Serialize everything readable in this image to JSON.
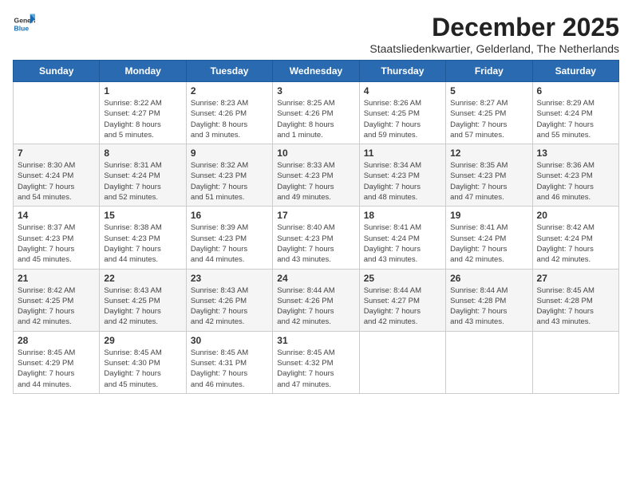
{
  "logo": {
    "line1": "General",
    "line2": "Blue"
  },
  "title": "December 2025",
  "subtitle": "Staatsliedenkwartier, Gelderland, The Netherlands",
  "days_of_week": [
    "Sunday",
    "Monday",
    "Tuesday",
    "Wednesday",
    "Thursday",
    "Friday",
    "Saturday"
  ],
  "weeks": [
    [
      {
        "day": "",
        "text": ""
      },
      {
        "day": "1",
        "text": "Sunrise: 8:22 AM\nSunset: 4:27 PM\nDaylight: 8 hours\nand 5 minutes."
      },
      {
        "day": "2",
        "text": "Sunrise: 8:23 AM\nSunset: 4:26 PM\nDaylight: 8 hours\nand 3 minutes."
      },
      {
        "day": "3",
        "text": "Sunrise: 8:25 AM\nSunset: 4:26 PM\nDaylight: 8 hours\nand 1 minute."
      },
      {
        "day": "4",
        "text": "Sunrise: 8:26 AM\nSunset: 4:25 PM\nDaylight: 7 hours\nand 59 minutes."
      },
      {
        "day": "5",
        "text": "Sunrise: 8:27 AM\nSunset: 4:25 PM\nDaylight: 7 hours\nand 57 minutes."
      },
      {
        "day": "6",
        "text": "Sunrise: 8:29 AM\nSunset: 4:24 PM\nDaylight: 7 hours\nand 55 minutes."
      }
    ],
    [
      {
        "day": "7",
        "text": "Sunrise: 8:30 AM\nSunset: 4:24 PM\nDaylight: 7 hours\nand 54 minutes."
      },
      {
        "day": "8",
        "text": "Sunrise: 8:31 AM\nSunset: 4:24 PM\nDaylight: 7 hours\nand 52 minutes."
      },
      {
        "day": "9",
        "text": "Sunrise: 8:32 AM\nSunset: 4:23 PM\nDaylight: 7 hours\nand 51 minutes."
      },
      {
        "day": "10",
        "text": "Sunrise: 8:33 AM\nSunset: 4:23 PM\nDaylight: 7 hours\nand 49 minutes."
      },
      {
        "day": "11",
        "text": "Sunrise: 8:34 AM\nSunset: 4:23 PM\nDaylight: 7 hours\nand 48 minutes."
      },
      {
        "day": "12",
        "text": "Sunrise: 8:35 AM\nSunset: 4:23 PM\nDaylight: 7 hours\nand 47 minutes."
      },
      {
        "day": "13",
        "text": "Sunrise: 8:36 AM\nSunset: 4:23 PM\nDaylight: 7 hours\nand 46 minutes."
      }
    ],
    [
      {
        "day": "14",
        "text": "Sunrise: 8:37 AM\nSunset: 4:23 PM\nDaylight: 7 hours\nand 45 minutes."
      },
      {
        "day": "15",
        "text": "Sunrise: 8:38 AM\nSunset: 4:23 PM\nDaylight: 7 hours\nand 44 minutes."
      },
      {
        "day": "16",
        "text": "Sunrise: 8:39 AM\nSunset: 4:23 PM\nDaylight: 7 hours\nand 44 minutes."
      },
      {
        "day": "17",
        "text": "Sunrise: 8:40 AM\nSunset: 4:23 PM\nDaylight: 7 hours\nand 43 minutes."
      },
      {
        "day": "18",
        "text": "Sunrise: 8:41 AM\nSunset: 4:24 PM\nDaylight: 7 hours\nand 43 minutes."
      },
      {
        "day": "19",
        "text": "Sunrise: 8:41 AM\nSunset: 4:24 PM\nDaylight: 7 hours\nand 42 minutes."
      },
      {
        "day": "20",
        "text": "Sunrise: 8:42 AM\nSunset: 4:24 PM\nDaylight: 7 hours\nand 42 minutes."
      }
    ],
    [
      {
        "day": "21",
        "text": "Sunrise: 8:42 AM\nSunset: 4:25 PM\nDaylight: 7 hours\nand 42 minutes."
      },
      {
        "day": "22",
        "text": "Sunrise: 8:43 AM\nSunset: 4:25 PM\nDaylight: 7 hours\nand 42 minutes."
      },
      {
        "day": "23",
        "text": "Sunrise: 8:43 AM\nSunset: 4:26 PM\nDaylight: 7 hours\nand 42 minutes."
      },
      {
        "day": "24",
        "text": "Sunrise: 8:44 AM\nSunset: 4:26 PM\nDaylight: 7 hours\nand 42 minutes."
      },
      {
        "day": "25",
        "text": "Sunrise: 8:44 AM\nSunset: 4:27 PM\nDaylight: 7 hours\nand 42 minutes."
      },
      {
        "day": "26",
        "text": "Sunrise: 8:44 AM\nSunset: 4:28 PM\nDaylight: 7 hours\nand 43 minutes."
      },
      {
        "day": "27",
        "text": "Sunrise: 8:45 AM\nSunset: 4:28 PM\nDaylight: 7 hours\nand 43 minutes."
      }
    ],
    [
      {
        "day": "28",
        "text": "Sunrise: 8:45 AM\nSunset: 4:29 PM\nDaylight: 7 hours\nand 44 minutes."
      },
      {
        "day": "29",
        "text": "Sunrise: 8:45 AM\nSunset: 4:30 PM\nDaylight: 7 hours\nand 45 minutes."
      },
      {
        "day": "30",
        "text": "Sunrise: 8:45 AM\nSunset: 4:31 PM\nDaylight: 7 hours\nand 46 minutes."
      },
      {
        "day": "31",
        "text": "Sunrise: 8:45 AM\nSunset: 4:32 PM\nDaylight: 7 hours\nand 47 minutes."
      },
      {
        "day": "",
        "text": ""
      },
      {
        "day": "",
        "text": ""
      },
      {
        "day": "",
        "text": ""
      }
    ]
  ]
}
